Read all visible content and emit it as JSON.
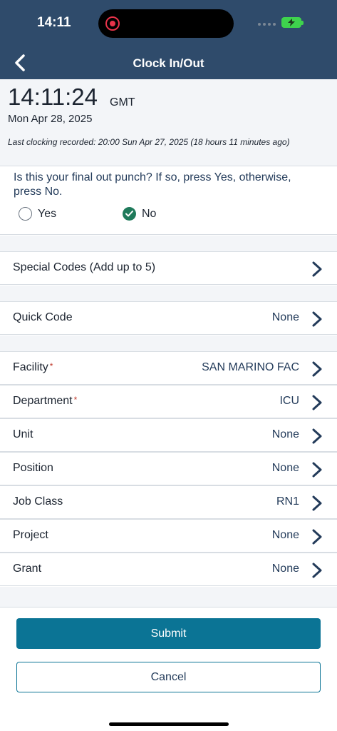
{
  "status": {
    "time": "14:11"
  },
  "header": {
    "title": "Clock In/Out"
  },
  "clock": {
    "time": "14:11:24",
    "timezone": "GMT",
    "date": "Mon Apr 28, 2025",
    "last_recorded": "Last clocking recorded:  20:00 Sun Apr 27, 2025 (18 hours 11 minutes ago)"
  },
  "question": {
    "text": "Is this your final out punch? If so, press Yes, otherwise, press No.",
    "yes_label": "Yes",
    "no_label": "No",
    "selected": "No"
  },
  "rows": {
    "special_codes": {
      "label": "Special Codes (Add up to 5)"
    },
    "quick_code": {
      "label": "Quick Code",
      "value": "None"
    },
    "facility": {
      "label": "Facility",
      "required": "*",
      "value": "SAN MARINO FAC"
    },
    "department": {
      "label": "Department",
      "required": "*",
      "value": "ICU"
    },
    "unit": {
      "label": "Unit",
      "value": "None"
    },
    "position": {
      "label": "Position",
      "value": "None"
    },
    "job_class": {
      "label": "Job Class",
      "value": "RN1"
    },
    "project": {
      "label": "Project",
      "value": "None"
    },
    "grant": {
      "label": "Grant",
      "value": "None"
    }
  },
  "actions": {
    "submit_label": "Submit",
    "cancel_label": "Cancel"
  },
  "colors": {
    "header": "#2f4b6b",
    "primary": "#0b7495",
    "selected_radio": "#1f7a5b",
    "required": "#c0392b"
  }
}
